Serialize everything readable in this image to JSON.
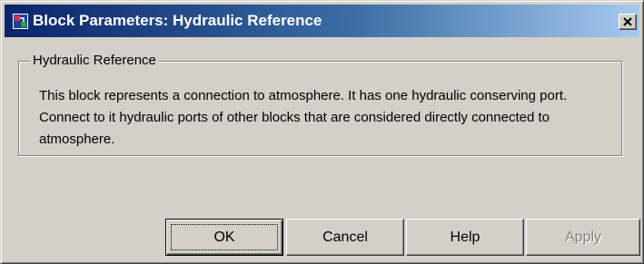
{
  "window": {
    "title": "Block Parameters: Hydraulic Reference",
    "icon": "simulink-block-icon",
    "close_icon": "close-icon"
  },
  "group": {
    "legend": "Hydraulic Reference",
    "description": "This block represents a connection to atmosphere. It has one hydraulic conserving port. Connect to it hydraulic ports of other blocks that are considered directly connected to atmosphere."
  },
  "buttons": {
    "ok": "OK",
    "cancel": "Cancel",
    "help": "Help",
    "apply": "Apply"
  },
  "colors": {
    "title_bar_start": "#0a246a",
    "title_bar_end": "#a6caf0",
    "dialog_face": "#d4d0c8",
    "disabled_text": "#808080"
  }
}
